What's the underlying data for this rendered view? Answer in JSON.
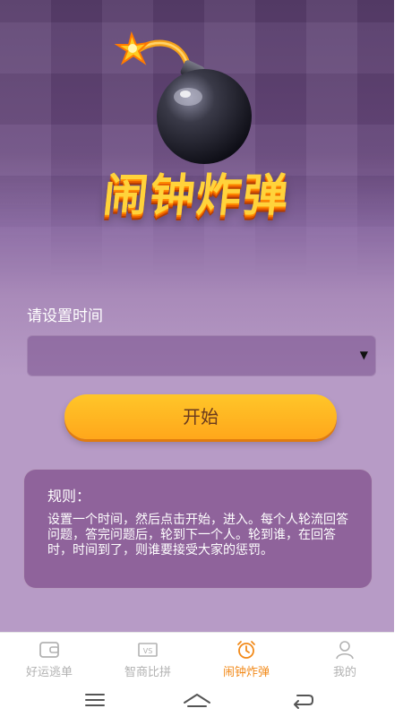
{
  "header": {
    "title": "闹钟炸弹"
  },
  "form": {
    "label": "请设置时间",
    "select_value": "",
    "start_label": "开始"
  },
  "rules": {
    "title": "规则：",
    "text": "设置一个时间，然后点击开始，进入。每个人轮流回答问题，答完问题后，轮到下一个人。轮到谁，在回答时，时间到了，则谁要接受大家的惩罚。"
  },
  "tabs": [
    {
      "label": "好运逃单",
      "icon": "wallet-icon",
      "active": false
    },
    {
      "label": "智商比拼",
      "icon": "vs-icon",
      "active": false
    },
    {
      "label": "闹钟炸弹",
      "icon": "alarm-clock-icon",
      "active": true
    },
    {
      "label": "我的",
      "icon": "user-icon",
      "active": false
    }
  ],
  "colors": {
    "accent": "#f28a1a",
    "button": "#ffb41f",
    "background": "#b79bc6"
  }
}
